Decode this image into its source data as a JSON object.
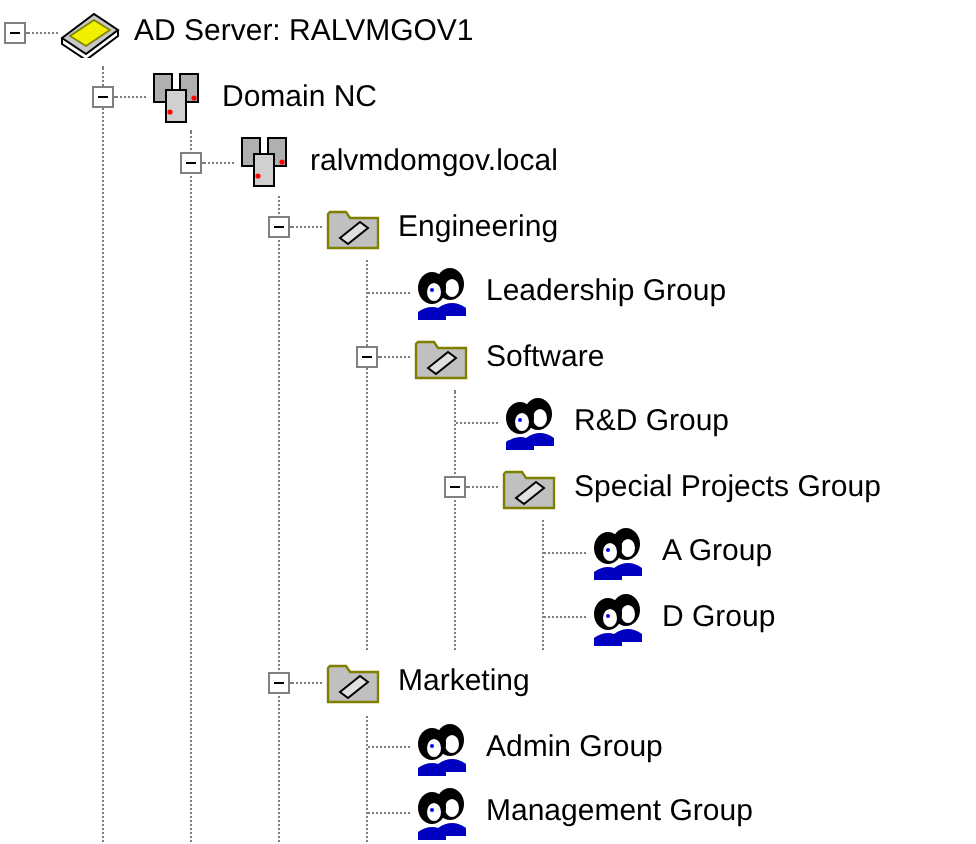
{
  "tree": [
    {
      "kind": "ad-server",
      "label": "AD Server: RALVMGOV1",
      "expanded": true,
      "children": [
        {
          "kind": "domain",
          "label": "Domain NC",
          "expanded": true,
          "children": [
            {
              "kind": "domain",
              "label": "ralvmdomgov.local",
              "expanded": true,
              "children": [
                {
                  "kind": "folder",
                  "label": "Engineering",
                  "expanded": true,
                  "children": [
                    {
                      "kind": "group",
                      "label": "Leadership Group"
                    },
                    {
                      "kind": "folder",
                      "label": "Software",
                      "expanded": true,
                      "children": [
                        {
                          "kind": "group",
                          "label": "R&D Group"
                        },
                        {
                          "kind": "folder",
                          "label": "Special Projects Group",
                          "expanded": true,
                          "children": [
                            {
                              "kind": "group",
                              "label": "A Group"
                            },
                            {
                              "kind": "group",
                              "label": "D Group"
                            }
                          ]
                        }
                      ]
                    }
                  ]
                },
                {
                  "kind": "folder",
                  "label": "Marketing",
                  "expanded": true,
                  "children": [
                    {
                      "kind": "group",
                      "label": "Admin Group"
                    },
                    {
                      "kind": "group",
                      "label": "Management Group"
                    }
                  ]
                }
              ]
            }
          ]
        }
      ]
    }
  ]
}
